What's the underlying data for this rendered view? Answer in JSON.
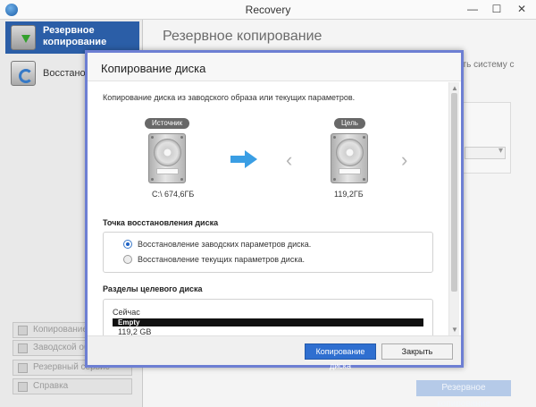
{
  "window": {
    "title": "Recovery",
    "controls": {
      "minimize": "—",
      "maximize": "☐",
      "close": "✕"
    }
  },
  "sidebar": {
    "items": [
      {
        "label": "Резервное копирование",
        "icon": "backup-icon",
        "active": true
      },
      {
        "label": "Восстановление",
        "icon": "restore-icon",
        "active": false
      }
    ],
    "bottom_buttons": [
      {
        "label": "Копирование диска"
      },
      {
        "label": "Заводской образ"
      },
      {
        "label": "Резервный сервис"
      },
      {
        "label": "Справка"
      }
    ]
  },
  "main": {
    "title": "Резервное копирование",
    "partial_text": "ить систему с",
    "bottom_button": "Резервное копирование"
  },
  "dialog": {
    "title": "Копирование диска",
    "description": "Копирование диска из заводского образа или текущих параметров.",
    "source": {
      "pill": "Источник",
      "caption": "C:\\ 674,6ГБ"
    },
    "target": {
      "pill": "Цель",
      "caption": "119,2ГБ"
    },
    "accent_color": "#3a9ee4",
    "restore_point": {
      "title": "Точка восстановления диска",
      "options": [
        {
          "label": "Восстановление заводских параметров диска.",
          "selected": true
        },
        {
          "label": "Восстановление текущих параметров диска.",
          "selected": false
        }
      ]
    },
    "partitions": {
      "title": "Разделы целевого диска",
      "current_label": "Сейчас",
      "bar_label": "Empty",
      "size": "119,2 GB"
    },
    "buttons": {
      "primary": "Копирование диска",
      "close": "Закрыть"
    }
  }
}
